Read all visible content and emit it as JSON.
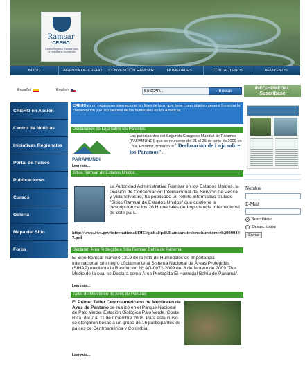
{
  "header": {
    "logo_name": "Ramsar",
    "logo_org": "CREHO",
    "logo_sub": "Centro Regional Ramsar para el Hemisferio Occidental"
  },
  "nav": {
    "items": [
      "INICIO",
      "AGENDA DE CREHO",
      "CONVENCIÓN RAMSAR",
      "HUMEDALES",
      "CONTACTENOS",
      "APOYENOS"
    ]
  },
  "lang": {
    "es": "Español",
    "en": "English"
  },
  "search": {
    "value": "BUSCAR...",
    "button": "Buscar"
  },
  "info_box": {
    "line1": "INFO-HUMEDAL",
    "line2": "Suscribase"
  },
  "sidebar": {
    "items": [
      "CREHO en Acción",
      "Centro de Noticias",
      "Iniciativas Regionales",
      "Portal de Países",
      "Publicaciones",
      "Cursos",
      "Galeria",
      "Mapa del Sitio",
      "Foros"
    ]
  },
  "intro": {
    "lead": "CREHO",
    "text": " es un organismo internacional sin fines de lucro que tiene como objetivo general fomentar la conservación y el uso racional de los humedales en las Américas."
  },
  "news": [
    {
      "title": "Declaración de Loja sobre los Páramos",
      "body": "Los participantes del Segundo Congreso Mundial de Páramos (PARAMUNDI) que se reunieron del 21 al 26 de junio de 2009 en Loja, Ecuador, firmaron la",
      "highlight": "\"Declaración de Loja sobre los Páramos\".",
      "logo_text": "PARAMUNDI",
      "more": "Leer más..."
    },
    {
      "title": "Sitios Ramsar de Estados Unidos",
      "body": "La Autoridad Administrativa Ramsar en los Estados Unidos, la División de Conservación Internacional del Servicio de Pesca y Vida Silvestre, ha publicado un folleto informativo titulado \"Sitios Ramsar de Estados Unidos\" que contiene la descripción de los 26 Humedales de Importancia Internacional de este país.",
      "link": "http://www.fws.gov/international/DIC/global/pdf/Ramsarsitesbrochureforweb20090407.pdf"
    },
    {
      "title": "Declaran Área Protegida a Sitio Ramsar Bahía de Panamá",
      "body": "El Sitio Ramsar número 1319 de la lista de Humedales de Importancia Internacional se integró oficialmente al Sistema Nacional de Áreas Protegidas (SINAP) mediante la Resolución Nº AG-0072-2009 del 3 de febrero de 2009 \"Por Medio de la cual se Declara como Área Protegida El Humedal Bahía de Panamá\".",
      "more": "Leer más..."
    },
    {
      "title": "Taller de Monitoreo de Aves de Pantano",
      "lead": "El Primer Taller Centroamericano de Monitoreo de Aves de Pantano",
      "body": " se realizó en el Parque Nacional de Palo Verde, Estación Biológica Palo Verde, Costa Rica, del 7 al 11 de diciembre 2008. Para este curso se otorgaron becas a un grupo de 16 participantes de países de Centroamérica y Colombia.",
      "more": "Leer más..."
    }
  ],
  "subscribe": {
    "name_label": "Nombre",
    "email_label": "E-Mail",
    "subscribe_option": "Suscribirse",
    "unsubscribe_option": "Desuscribirse",
    "send": "Enviar"
  }
}
